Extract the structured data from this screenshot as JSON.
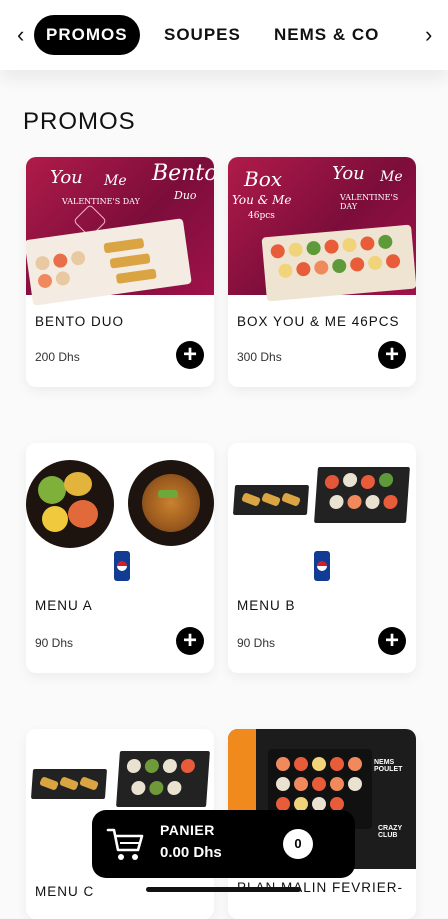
{
  "nav": {
    "prev_icon": "‹",
    "next_icon": "›",
    "tabs": [
      {
        "label": "PROMOS",
        "active": true
      },
      {
        "label": "SOUPES",
        "active": false
      },
      {
        "label": "NEMS & CO",
        "active": false
      }
    ]
  },
  "section": {
    "title": "PROMOS"
  },
  "products": [
    {
      "name": "BENTO DUO",
      "price": "200 Dhs",
      "image_text": [
        "You",
        "Me",
        "Bento",
        "Duo",
        "VALENTINE'S DAY"
      ]
    },
    {
      "name": "BOX YOU & ME 46PCS",
      "price": "300 Dhs",
      "image_text": [
        "Box",
        "You & Me",
        "46pcs",
        "You",
        "Me",
        "VALENTINE'S DAY"
      ]
    },
    {
      "name": "MENU A",
      "price": "90 Dhs"
    },
    {
      "name": "MENU B",
      "price": "90 Dhs"
    },
    {
      "name": "MENU C",
      "price": ""
    },
    {
      "name": "PLAN MALIN FEVRIER-",
      "price": "",
      "image_text": [
        "NEMS POULET",
        "CRAZY CLUB"
      ]
    }
  ],
  "add_icon": "+",
  "cart": {
    "label": "PANIER",
    "total": "0.00 Dhs",
    "count": "0",
    "icon": "cart-icon"
  },
  "colors": {
    "accent": "#000000",
    "promo_bg": "#9e1447",
    "orange": "#f08a1d"
  }
}
